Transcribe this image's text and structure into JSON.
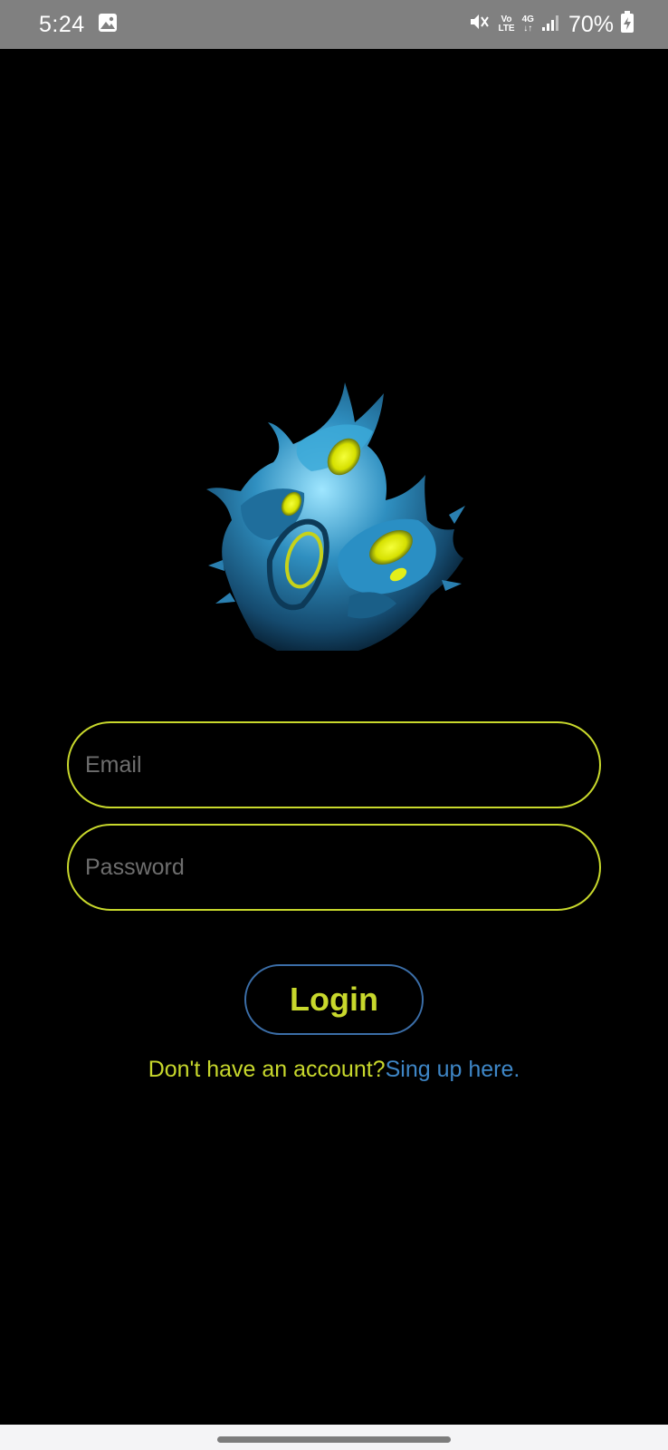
{
  "status_bar": {
    "time": "5:24",
    "volte_top": "Vo",
    "volte_bottom": "LTE",
    "network_type": "4G",
    "battery_percent": "70%"
  },
  "form": {
    "email_placeholder": "Email",
    "password_placeholder": "Password",
    "login_label": "Login",
    "signup_prompt": "Don't have an account?",
    "signup_link": "Sing up here."
  },
  "colors": {
    "accent": "#c8d82c",
    "link": "#3e86c6",
    "button_border": "#3b6ea8",
    "background": "#000000"
  }
}
